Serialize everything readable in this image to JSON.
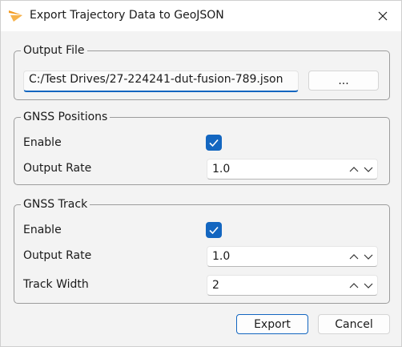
{
  "window": {
    "title": "Export Trajectory Data to GeoJSON"
  },
  "output_file": {
    "group_label": "Output File",
    "path_value": "C:/Test Drives/27-224241-dut-fusion-789.json",
    "browse_label": "..."
  },
  "gnss_positions": {
    "group_label": "GNSS Positions",
    "enable_label": "Enable",
    "enable_checked": true,
    "output_rate_label": "Output Rate",
    "output_rate_value": "1.0"
  },
  "gnss_track": {
    "group_label": "GNSS Track",
    "enable_label": "Enable",
    "enable_checked": true,
    "output_rate_label": "Output Rate",
    "output_rate_value": "1.0",
    "track_width_label": "Track Width",
    "track_width_value": "2"
  },
  "footer": {
    "export_label": "Export",
    "cancel_label": "Cancel"
  },
  "colors": {
    "accent": "#1366c0",
    "app_icon": "#f39a1e"
  }
}
